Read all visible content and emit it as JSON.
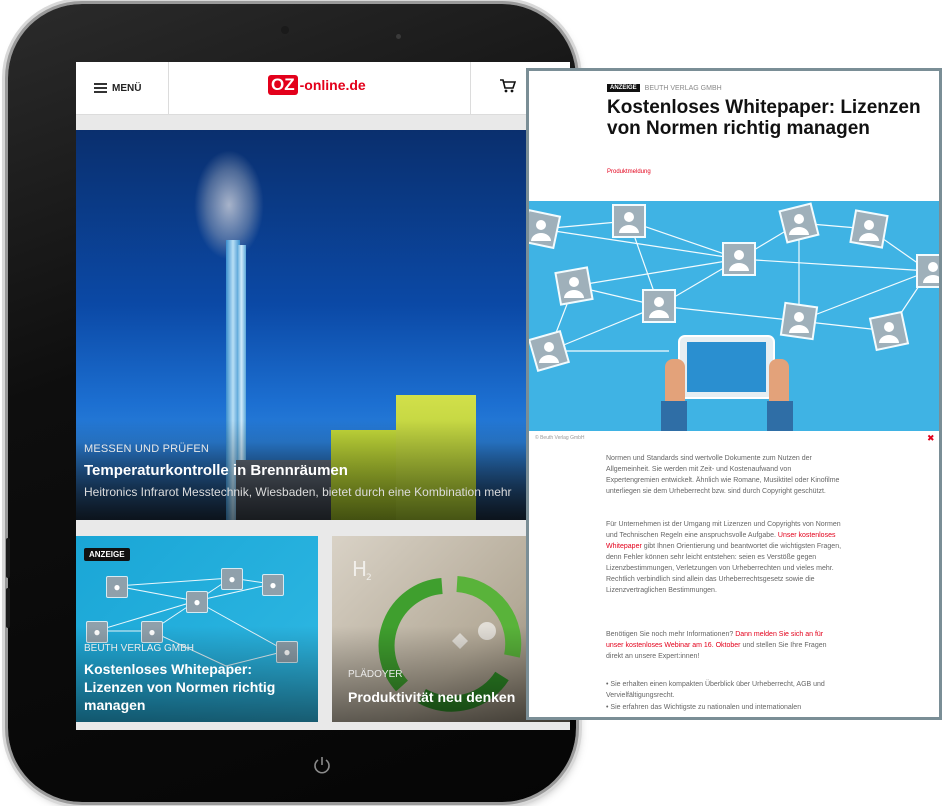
{
  "header": {
    "menu_label": "MENÜ",
    "logo_mark": "OZ",
    "logo_text": "-online.de"
  },
  "hero": {
    "kicker": "MESSEN UND PRÜFEN",
    "title": "Temperaturkontrolle in Brennräumen",
    "subtitle": "Heitronics Infrarot Messtechnik, Wiesbaden, bietet durch eine Kombination mehr"
  },
  "cards": [
    {
      "badge": "ANZEIGE",
      "kicker": "BEUTH VERLAG GMBH",
      "title": "Kostenloses Whitepaper: Lizenzen von Normen richtig managen"
    },
    {
      "kicker": "PLÄDOYER",
      "title": "Produktivität neu denken"
    }
  ],
  "article": {
    "badge": "ANZEIGE",
    "publisher": "BEUTH VERLAG GMBH",
    "title": "Kostenloses Whitepaper: Lizenzen von Normen richtig managen",
    "category": "Produktmeldung",
    "credit": "© Beuth Verlag GmbH",
    "para1": "Normen und Standards sind wertvolle Dokumente zum Nutzen der Allgemeinheit. Sie werden mit Zeit- und Kostenaufwand von Expertengremien entwickelt. Ähnlich wie Romane, Musiktitel oder Kinofilme unterliegen sie dem Urheberrecht bzw. sind durch Copyright geschützt.",
    "para2_a": "Für Unternehmen ist der Umgang mit Lizenzen und Copyrights von Normen und Technischen Regeln eine anspruchsvolle Aufgabe. ",
    "para2_link": "Unser kostenloses Whitepaper",
    "para2_b": " gibt Ihnen Orientierung und beantwortet die wichtigsten Fragen, denn Fehler können sehr leicht entstehen: seien es Verstöße gegen Lizenzbestimmungen, Verletzungen von Urheberrechten und vieles mehr. Rechtlich verbindlich sind allein das Urheberrechtsgesetz sowie die Lizenzvertraglichen Bestimmungen.",
    "para3_a": "Benötigen Sie noch mehr Informationen? ",
    "para3_link": "Dann melden Sie sich an für unser kostenloses Webinar am 16. Oktober",
    "para3_b": " und stellen Sie Ihre Fragen direkt an unsere Expert:innen!",
    "bullets": [
      "Sie erhalten einen kompakten Überblick über Urheberrecht, AGB und Vervielfältigungsrecht.",
      "Sie erfahren das Wichtigste zu nationalen und internationalen"
    ]
  },
  "colors": {
    "brand_red": "#e3001b",
    "panel_border": "#7a8e96",
    "illustration_bg": "#3fb3e4"
  },
  "icons": [
    "hamburger-icon",
    "cart-icon",
    "close-icon",
    "person-icon",
    "tablet-icon",
    "home-button-icon"
  ]
}
